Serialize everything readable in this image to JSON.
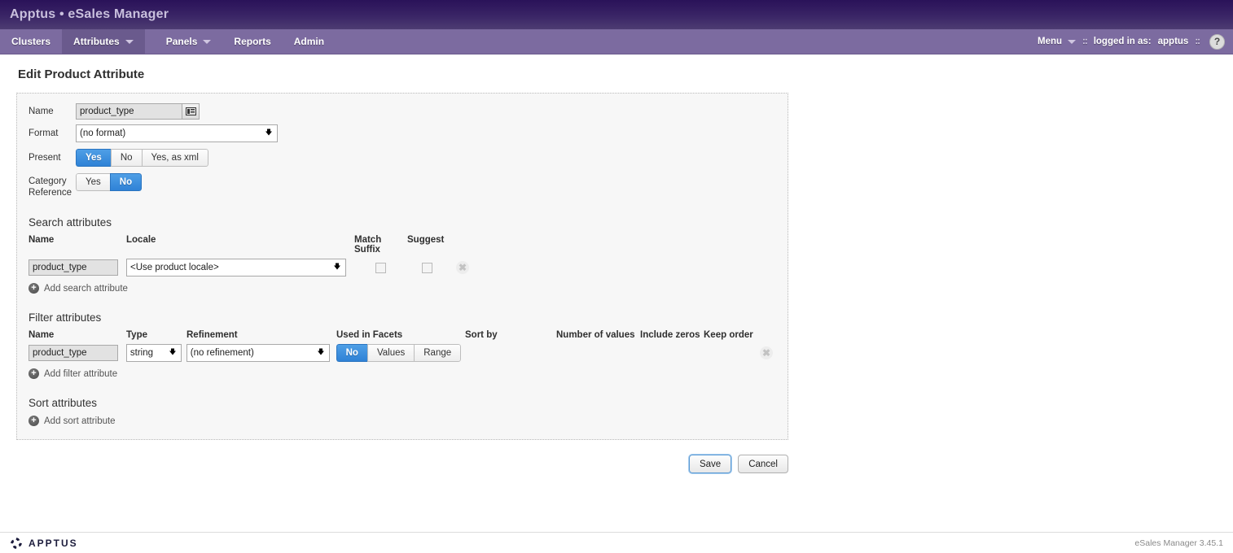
{
  "header": {
    "app_title": "Apptus • eSales Manager",
    "nav": [
      {
        "label": "Clusters",
        "has_caret": false,
        "active": false
      },
      {
        "label": "Attributes",
        "has_caret": true,
        "active": true
      },
      {
        "label": "Panels",
        "has_caret": true,
        "active": false
      },
      {
        "label": "Reports",
        "has_caret": false,
        "active": false
      },
      {
        "label": "Admin",
        "has_caret": false,
        "active": false
      }
    ],
    "menu_label": "Menu",
    "sep_left": "::",
    "logged_in_label": "logged in as:",
    "username": "apptus",
    "sep_right": "::",
    "help_label": "?"
  },
  "page": {
    "title": "Edit Product Attribute"
  },
  "form": {
    "name_label": "Name",
    "name_value": "product_type",
    "name_icon": "card-list-icon",
    "format_label": "Format",
    "format_value": "(no format)",
    "present_label": "Present",
    "present_options": [
      "Yes",
      "No",
      "Yes, as xml"
    ],
    "present_selected": "Yes",
    "category_reference_label_line1": "Category",
    "category_reference_label_line2": "Reference",
    "category_reference_options": [
      "Yes",
      "No"
    ],
    "category_reference_selected": "No"
  },
  "search_attributes": {
    "section_title": "Search attributes",
    "columns": [
      "Name",
      "Locale",
      "Match Suffix",
      "Suggest"
    ],
    "rows": [
      {
        "name": "product_type",
        "locale": "<Use product locale>",
        "match_suffix": false,
        "suggest": false,
        "remove_label": "✖"
      }
    ],
    "add_label": "Add search attribute"
  },
  "filter_attributes": {
    "section_title": "Filter attributes",
    "columns": [
      "Name",
      "Type",
      "Refinement",
      "Used in Facets",
      "Sort by",
      "Number of values",
      "Include zeros",
      "Keep order"
    ],
    "rows": [
      {
        "name": "product_type",
        "type": "string",
        "refinement": "(no refinement)",
        "used_in_facets_options": [
          "No",
          "Values",
          "Range"
        ],
        "used_in_facets_selected": "No",
        "sort_by": "",
        "number_of_values": "",
        "include_zeros": "",
        "keep_order": "",
        "remove_label": "✖"
      }
    ],
    "add_label": "Add filter attribute"
  },
  "sort_attributes": {
    "section_title": "Sort attributes",
    "add_label": "Add sort attribute"
  },
  "actions": {
    "save_label": "Save",
    "cancel_label": "Cancel"
  },
  "footer": {
    "logo_text": "APPTUS",
    "version": "eSales Manager 3.45.1"
  },
  "colors": {
    "title_bar_top": "#2a1259",
    "title_bar_bottom": "#4d3c72",
    "nav_bar": "#7c6ba0",
    "nav_active": "#6a5a8d",
    "accent_blue": "#2f82d6",
    "panel_bg": "#f7f7f7",
    "logo_navy": "#1c1c3c"
  }
}
